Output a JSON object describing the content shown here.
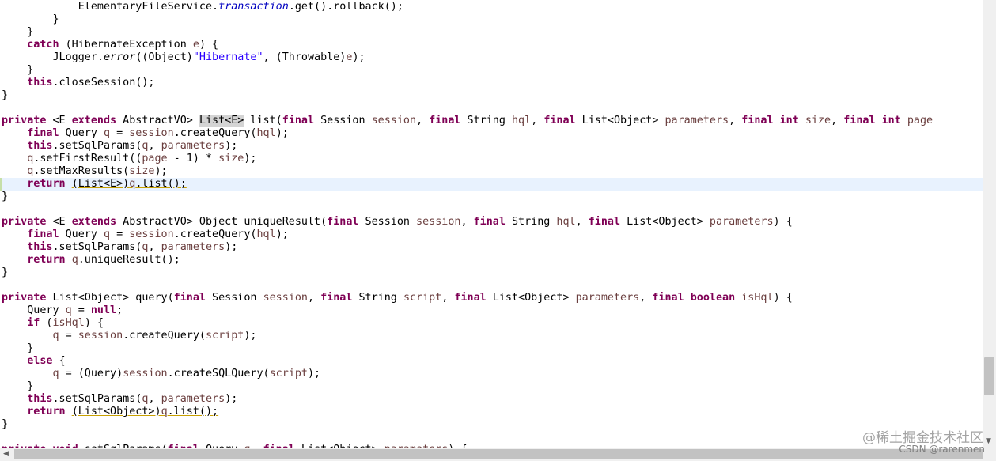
{
  "editor": {
    "current_line_index": 14,
    "lines": [
      {
        "indent": "            ",
        "tokens": [
          {
            "t": "ElementaryFileService."
          },
          {
            "t": "transaction",
            "c": "f"
          },
          {
            "t": ".get().rollback();"
          }
        ]
      },
      {
        "indent": "        ",
        "tokens": [
          {
            "t": "}"
          }
        ]
      },
      {
        "indent": "    ",
        "tokens": [
          {
            "t": "}"
          }
        ]
      },
      {
        "indent": "    ",
        "tokens": [
          {
            "t": "catch",
            "c": "k"
          },
          {
            "t": " (HibernateException "
          },
          {
            "t": "e",
            "c": "v"
          },
          {
            "t": ") {"
          }
        ]
      },
      {
        "indent": "        ",
        "tokens": [
          {
            "t": "JLogger."
          },
          {
            "t": "error",
            "c": "m"
          },
          {
            "t": "((Object)"
          },
          {
            "t": "\"Hibernate\"",
            "c": "s"
          },
          {
            "t": ", (Throwable)"
          },
          {
            "t": "e",
            "c": "v"
          },
          {
            "t": ");"
          }
        ]
      },
      {
        "indent": "    ",
        "tokens": [
          {
            "t": "}"
          }
        ]
      },
      {
        "indent": "    ",
        "tokens": [
          {
            "t": "this",
            "c": "k"
          },
          {
            "t": ".closeSession();"
          }
        ]
      },
      {
        "indent": "",
        "tokens": [
          {
            "t": "}"
          }
        ]
      },
      {
        "indent": "",
        "tokens": []
      },
      {
        "indent": "",
        "tokens": [
          {
            "t": "private",
            "c": "k"
          },
          {
            "t": " <E "
          },
          {
            "t": "extends",
            "c": "k"
          },
          {
            "t": " AbstractVO> "
          },
          {
            "t": "List<E>",
            "c": "hl"
          },
          {
            "t": " list("
          },
          {
            "t": "final",
            "c": "k"
          },
          {
            "t": " Session "
          },
          {
            "t": "session",
            "c": "v"
          },
          {
            "t": ", "
          },
          {
            "t": "final",
            "c": "k"
          },
          {
            "t": " String "
          },
          {
            "t": "hql",
            "c": "v"
          },
          {
            "t": ", "
          },
          {
            "t": "final",
            "c": "k"
          },
          {
            "t": " List<Object> "
          },
          {
            "t": "parameters",
            "c": "v"
          },
          {
            "t": ", "
          },
          {
            "t": "final",
            "c": "k"
          },
          {
            "t": " "
          },
          {
            "t": "int",
            "c": "k"
          },
          {
            "t": " "
          },
          {
            "t": "size",
            "c": "v"
          },
          {
            "t": ", "
          },
          {
            "t": "final",
            "c": "k"
          },
          {
            "t": " "
          },
          {
            "t": "int",
            "c": "k"
          },
          {
            "t": " "
          },
          {
            "t": "page",
            "c": "v"
          }
        ]
      },
      {
        "indent": "    ",
        "tokens": [
          {
            "t": "final",
            "c": "k"
          },
          {
            "t": " Query "
          },
          {
            "t": "q",
            "c": "v"
          },
          {
            "t": " = "
          },
          {
            "t": "session",
            "c": "v"
          },
          {
            "t": ".createQuery("
          },
          {
            "t": "hql",
            "c": "v"
          },
          {
            "t": ");"
          }
        ]
      },
      {
        "indent": "    ",
        "tokens": [
          {
            "t": "this",
            "c": "k"
          },
          {
            "t": ".setSqlParams("
          },
          {
            "t": "q",
            "c": "v"
          },
          {
            "t": ", "
          },
          {
            "t": "parameters",
            "c": "v"
          },
          {
            "t": ");"
          }
        ]
      },
      {
        "indent": "    ",
        "tokens": [
          {
            "t": "q",
            "c": "v"
          },
          {
            "t": ".setFirstResult(("
          },
          {
            "t": "page",
            "c": "v"
          },
          {
            "t": " - 1) * "
          },
          {
            "t": "size",
            "c": "v"
          },
          {
            "t": ");"
          }
        ]
      },
      {
        "indent": "    ",
        "tokens": [
          {
            "t": "q",
            "c": "v"
          },
          {
            "t": ".setMaxResults("
          },
          {
            "t": "size",
            "c": "v"
          },
          {
            "t": ");"
          }
        ]
      },
      {
        "indent": "    ",
        "tokens": [
          {
            "t": "return",
            "c": "k"
          },
          {
            "t": " "
          },
          {
            "t": "(List<E>)",
            "c": "ul"
          },
          {
            "t": "q",
            "c": "v ul"
          },
          {
            "t": ".list();",
            "c": "ul"
          }
        ]
      },
      {
        "indent": "",
        "tokens": [
          {
            "t": "}"
          }
        ]
      },
      {
        "indent": "",
        "tokens": []
      },
      {
        "indent": "",
        "tokens": [
          {
            "t": "private",
            "c": "k"
          },
          {
            "t": " <E "
          },
          {
            "t": "extends",
            "c": "k"
          },
          {
            "t": " AbstractVO> Object uniqueResult("
          },
          {
            "t": "final",
            "c": "k"
          },
          {
            "t": " Session "
          },
          {
            "t": "session",
            "c": "v"
          },
          {
            "t": ", "
          },
          {
            "t": "final",
            "c": "k"
          },
          {
            "t": " String "
          },
          {
            "t": "hql",
            "c": "v"
          },
          {
            "t": ", "
          },
          {
            "t": "final",
            "c": "k"
          },
          {
            "t": " List<Object> "
          },
          {
            "t": "parameters",
            "c": "v"
          },
          {
            "t": ") {"
          }
        ]
      },
      {
        "indent": "    ",
        "tokens": [
          {
            "t": "final",
            "c": "k"
          },
          {
            "t": " Query "
          },
          {
            "t": "q",
            "c": "v"
          },
          {
            "t": " = "
          },
          {
            "t": "session",
            "c": "v"
          },
          {
            "t": ".createQuery("
          },
          {
            "t": "hql",
            "c": "v"
          },
          {
            "t": ");"
          }
        ]
      },
      {
        "indent": "    ",
        "tokens": [
          {
            "t": "this",
            "c": "k"
          },
          {
            "t": ".setSqlParams("
          },
          {
            "t": "q",
            "c": "v"
          },
          {
            "t": ", "
          },
          {
            "t": "parameters",
            "c": "v"
          },
          {
            "t": ");"
          }
        ]
      },
      {
        "indent": "    ",
        "tokens": [
          {
            "t": "return",
            "c": "k"
          },
          {
            "t": " "
          },
          {
            "t": "q",
            "c": "v"
          },
          {
            "t": ".uniqueResult();"
          }
        ]
      },
      {
        "indent": "",
        "tokens": [
          {
            "t": "}"
          }
        ]
      },
      {
        "indent": "",
        "tokens": []
      },
      {
        "indent": "",
        "tokens": [
          {
            "t": "private",
            "c": "k"
          },
          {
            "t": " List<Object> query("
          },
          {
            "t": "final",
            "c": "k"
          },
          {
            "t": " Session "
          },
          {
            "t": "session",
            "c": "v"
          },
          {
            "t": ", "
          },
          {
            "t": "final",
            "c": "k"
          },
          {
            "t": " String "
          },
          {
            "t": "script",
            "c": "v"
          },
          {
            "t": ", "
          },
          {
            "t": "final",
            "c": "k"
          },
          {
            "t": " List<Object> "
          },
          {
            "t": "parameters",
            "c": "v"
          },
          {
            "t": ", "
          },
          {
            "t": "final",
            "c": "k"
          },
          {
            "t": " "
          },
          {
            "t": "boolean",
            "c": "k"
          },
          {
            "t": " "
          },
          {
            "t": "isHql",
            "c": "v"
          },
          {
            "t": ") {"
          }
        ]
      },
      {
        "indent": "    ",
        "tokens": [
          {
            "t": "Query "
          },
          {
            "t": "q",
            "c": "v"
          },
          {
            "t": " = "
          },
          {
            "t": "null",
            "c": "k"
          },
          {
            "t": ";"
          }
        ]
      },
      {
        "indent": "    ",
        "tokens": [
          {
            "t": "if",
            "c": "k"
          },
          {
            "t": " ("
          },
          {
            "t": "isHql",
            "c": "v"
          },
          {
            "t": ") {"
          }
        ]
      },
      {
        "indent": "        ",
        "tokens": [
          {
            "t": "q",
            "c": "v"
          },
          {
            "t": " = "
          },
          {
            "t": "session",
            "c": "v"
          },
          {
            "t": ".createQuery("
          },
          {
            "t": "script",
            "c": "v"
          },
          {
            "t": ");"
          }
        ]
      },
      {
        "indent": "    ",
        "tokens": [
          {
            "t": "}"
          }
        ]
      },
      {
        "indent": "    ",
        "tokens": [
          {
            "t": "else",
            "c": "k"
          },
          {
            "t": " {"
          }
        ]
      },
      {
        "indent": "        ",
        "tokens": [
          {
            "t": "q",
            "c": "v"
          },
          {
            "t": " = (Query)"
          },
          {
            "t": "session",
            "c": "v"
          },
          {
            "t": ".createSQLQuery("
          },
          {
            "t": "script",
            "c": "v"
          },
          {
            "t": ");"
          }
        ]
      },
      {
        "indent": "    ",
        "tokens": [
          {
            "t": "}"
          }
        ]
      },
      {
        "indent": "    ",
        "tokens": [
          {
            "t": "this",
            "c": "k"
          },
          {
            "t": ".setSqlParams("
          },
          {
            "t": "q",
            "c": "v"
          },
          {
            "t": ", "
          },
          {
            "t": "parameters",
            "c": "v"
          },
          {
            "t": ");"
          }
        ]
      },
      {
        "indent": "    ",
        "tokens": [
          {
            "t": "return",
            "c": "k"
          },
          {
            "t": " "
          },
          {
            "t": "(List<Object>)",
            "c": "ul"
          },
          {
            "t": "q",
            "c": "v ul"
          },
          {
            "t": ".list();",
            "c": "ul"
          }
        ]
      },
      {
        "indent": "",
        "tokens": [
          {
            "t": "}"
          }
        ]
      },
      {
        "indent": "",
        "tokens": []
      },
      {
        "indent": "",
        "tokens": [
          {
            "t": "private",
            "c": "k"
          },
          {
            "t": " "
          },
          {
            "t": "void",
            "c": "k"
          },
          {
            "t": " setSqlParams("
          },
          {
            "t": "final",
            "c": "k"
          },
          {
            "t": " Query "
          },
          {
            "t": "q",
            "c": "v"
          },
          {
            "t": ", "
          },
          {
            "t": "final",
            "c": "k"
          },
          {
            "t": " List<Object> "
          },
          {
            "t": "parameters",
            "c": "v"
          },
          {
            "t": ") {"
          }
        ]
      }
    ]
  },
  "scrollbars": {
    "up_arrow_icon": "chevron-up-icon",
    "down_arrow_icon": "chevron-down-icon",
    "left_arrow_icon": "chevron-left-icon"
  },
  "watermark": {
    "line1": "@稀土掘金技术社区",
    "line2": "CSDN @rarenmen"
  }
}
